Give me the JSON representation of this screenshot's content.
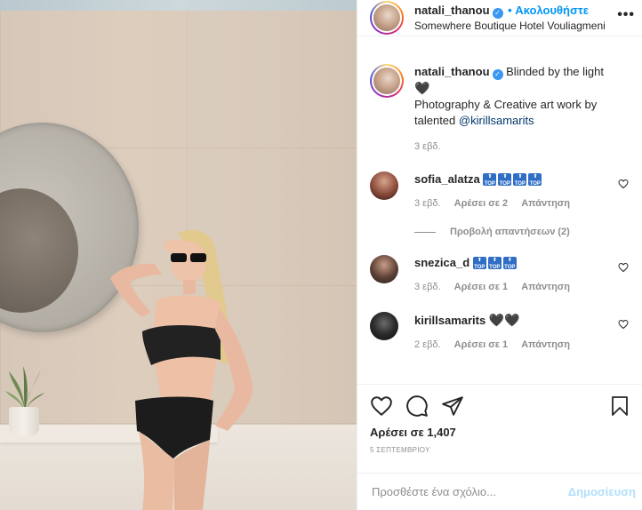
{
  "post": {
    "author": "natali_thanou",
    "follow_label": "• Ακολουθήστε",
    "location": "Somewhere Boutique Hotel Vouliagmeni",
    "more_label": "•••",
    "caption": {
      "username": "natali_thanou",
      "line1": "Blinded by the light",
      "emoji": "🖤",
      "line2": "Photography & Creative art work by talented",
      "mention": "@kirillsamarits",
      "time": "3 εβδ."
    }
  },
  "comments": [
    {
      "username": "sofia_alatza",
      "emoji_count": 4,
      "emoji_name": "top-arrow-emoji",
      "time": "3 εβδ.",
      "likes": "Αρέσει σε 2",
      "reply": "Απάντηση",
      "view_replies": "Προβολή απαντήσεων (2)"
    },
    {
      "username": "snezica_d",
      "emoji_count": 3,
      "emoji_name": "top-arrow-emoji",
      "time": "3 εβδ.",
      "likes": "Αρέσει σε 1",
      "reply": "Απάντηση"
    },
    {
      "username": "kirillsamarits",
      "text": "🖤🖤",
      "time": "2 εβδ.",
      "likes": "Αρέσει σε 1",
      "reply": "Απάντηση"
    }
  ],
  "actions": {
    "likes": "Αρέσει σε 1,407",
    "date": "5 ΣΕΠΤΕΜΒΡΙΟΥ",
    "icons": [
      "heart-icon",
      "comment-icon",
      "share-icon",
      "bookmark-icon"
    ]
  },
  "add_comment": {
    "placeholder": "Προσθέστε ένα σχόλιο...",
    "post_label": "Δημοσίευση"
  },
  "colors": {
    "accent": "#0095f6",
    "muted": "#8e8e8e",
    "post_disabled": "#b2dffc"
  }
}
